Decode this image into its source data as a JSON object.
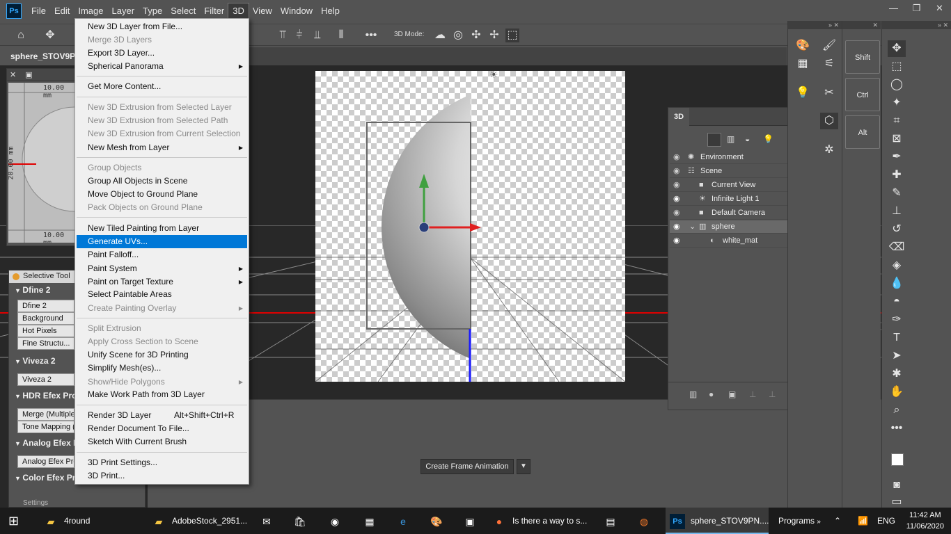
{
  "app": {
    "logo": "Ps",
    "menus": [
      "File",
      "Edit",
      "Image",
      "Layer",
      "Type",
      "Select",
      "Filter",
      "3D",
      "View",
      "Window",
      "Help"
    ],
    "active_menu": "3D",
    "window_controls": [
      "—",
      "❐",
      "✕"
    ]
  },
  "options_bar": {
    "mode_label": "3D Mode:"
  },
  "document": {
    "tab_title": "sphere_STOV9PN..."
  },
  "navigator": {
    "ruler_top": "10.00 mm",
    "ruler_bottom": "10.00 mm",
    "ruler_side": "20.00 mm"
  },
  "selective_tool": {
    "title": "Selective Tool",
    "groups": [
      {
        "name": "Dfine 2",
        "items": [
          "Dfine 2",
          "Background",
          "Hot Pixels",
          "Fine Structu..."
        ]
      },
      {
        "name": "Viveza 2",
        "items": [
          "Viveza 2"
        ]
      },
      {
        "name": "HDR Efex Pro",
        "items": [
          "Merge (Multiple",
          "Tone Mapping ("
        ]
      },
      {
        "name": "Analog Efex P",
        "items": [
          "Analog Efex Pro"
        ]
      },
      {
        "name": "Color Efex Pro 4",
        "items": []
      }
    ],
    "footer": "Settings"
  },
  "menu_3d": {
    "items": [
      {
        "label": "New 3D Layer from File...",
        "enabled": true
      },
      {
        "label": "Merge 3D Layers",
        "enabled": false
      },
      {
        "label": "Export 3D Layer...",
        "enabled": true
      },
      {
        "label": "Spherical Panorama",
        "enabled": true,
        "submenu": true
      },
      {
        "label": "Get More Content...",
        "enabled": true
      },
      {
        "label": "New 3D Extrusion from Selected Layer",
        "enabled": false
      },
      {
        "label": "New 3D Extrusion from Selected Path",
        "enabled": false
      },
      {
        "label": "New 3D Extrusion from Current Selection",
        "enabled": false
      },
      {
        "label": "New Mesh from Layer",
        "enabled": true,
        "submenu": true
      },
      {
        "label": "Group Objects",
        "enabled": false
      },
      {
        "label": "Group All Objects in Scene",
        "enabled": true
      },
      {
        "label": "Move Object to Ground Plane",
        "enabled": true
      },
      {
        "label": "Pack Objects on Ground Plane",
        "enabled": false
      },
      {
        "label": "New Tiled Painting from Layer",
        "enabled": true
      },
      {
        "label": "Generate UVs...",
        "enabled": true,
        "highlighted": true
      },
      {
        "label": "Paint Falloff...",
        "enabled": true
      },
      {
        "label": "Paint System",
        "enabled": true,
        "submenu": true
      },
      {
        "label": "Paint on Target Texture",
        "enabled": true,
        "submenu": true
      },
      {
        "label": "Select Paintable Areas",
        "enabled": true
      },
      {
        "label": "Create Painting Overlay",
        "enabled": false,
        "submenu": true
      },
      {
        "label": "Split Extrusion",
        "enabled": false
      },
      {
        "label": "Apply Cross Section to Scene",
        "enabled": false
      },
      {
        "label": "Unify Scene for 3D Printing",
        "enabled": true
      },
      {
        "label": "Simplify Mesh(es)...",
        "enabled": true
      },
      {
        "label": "Show/Hide Polygons",
        "enabled": false,
        "submenu": true
      },
      {
        "label": "Make Work Path from 3D Layer",
        "enabled": true
      },
      {
        "label": "Render 3D Layer",
        "enabled": true,
        "shortcut": "Alt+Shift+Ctrl+R"
      },
      {
        "label": "Render Document To File...",
        "enabled": true
      },
      {
        "label": "Sketch With Current Brush",
        "enabled": true
      },
      {
        "label": "3D Print Settings...",
        "enabled": true
      },
      {
        "label": "3D Print...",
        "enabled": true
      }
    ]
  },
  "panel_3d": {
    "tab": "3D",
    "rows": [
      {
        "label": "Environment",
        "icon": "environment-icon",
        "visible": false,
        "selected": false
      },
      {
        "label": "Scene",
        "icon": "scene-icon",
        "visible": false,
        "selected": false
      },
      {
        "label": "Current View",
        "icon": "camera-icon",
        "visible": false,
        "selected": false
      },
      {
        "label": "Infinite Light 1",
        "icon": "light-icon",
        "visible": true,
        "selected": false
      },
      {
        "label": "Default Camera",
        "icon": "camera-icon",
        "visible": false,
        "selected": false
      },
      {
        "label": "sphere",
        "icon": "mesh-icon",
        "visible": true,
        "selected": true
      },
      {
        "label": "white_mat",
        "icon": "material-icon",
        "visible": true,
        "selected": false
      }
    ]
  },
  "key_buttons": [
    "Shift",
    "Ctrl",
    "Alt"
  ],
  "timeline": {
    "button": "Create Frame Animation"
  },
  "taskbar": {
    "items": [
      {
        "label": "4round",
        "icon": "folder-icon"
      },
      {
        "label": "AdobeStock_2951...",
        "icon": "folder-icon"
      },
      {
        "label": "Is there a way to s...",
        "icon": "firefox-icon"
      },
      {
        "label": "sphere_STOV9PN....",
        "icon": "photoshop-icon"
      },
      {
        "label": "Programs",
        "icon": ""
      }
    ],
    "language": "ENG",
    "time": "11:42 AM",
    "date": "11/06/2020"
  },
  "colors": {
    "highlight": "#0078d7",
    "panel_bg": "#535353",
    "workspace_bg": "#282828",
    "axis_red": "#e00000",
    "axis_green": "#3fa03f",
    "axis_blue": "#1a1aff"
  }
}
